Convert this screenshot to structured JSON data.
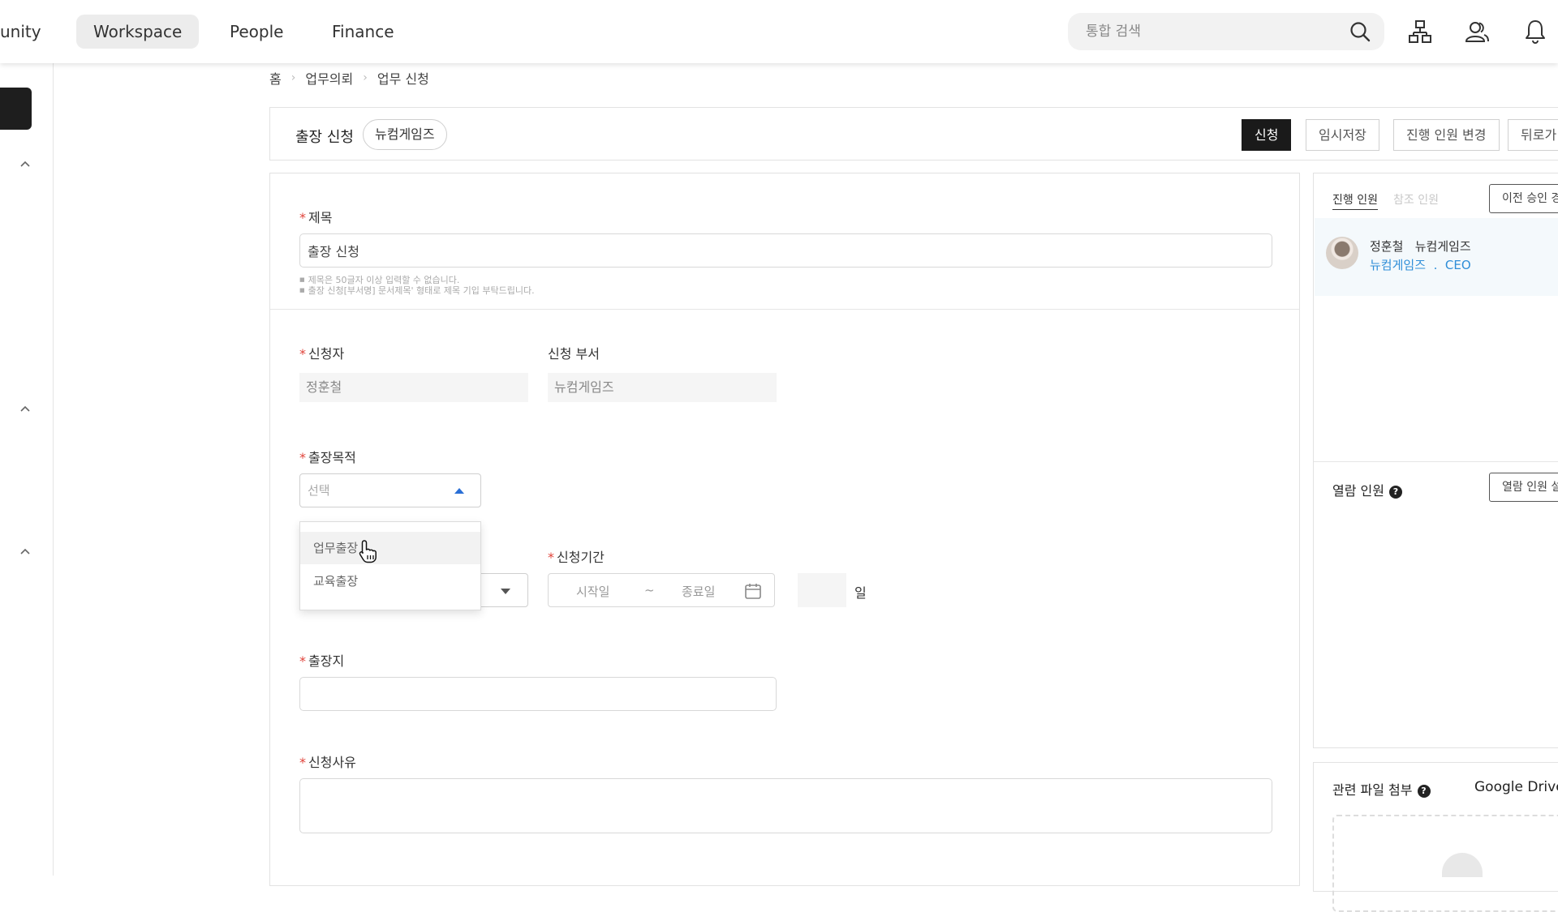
{
  "topnav": {
    "items": [
      {
        "label": "Community",
        "display": "unity",
        "active": false
      },
      {
        "label": "Workspace",
        "active": true
      },
      {
        "label": "People",
        "active": false
      },
      {
        "label": "Finance",
        "active": false
      }
    ],
    "search": {
      "placeholder": "통합 검색"
    },
    "icons": [
      "search-icon",
      "org-chart-icon",
      "contacts-icon",
      "bell-icon"
    ]
  },
  "breadcrumb": [
    "홈",
    "업무의뢰",
    "업무 신청"
  ],
  "header": {
    "title": "출장 신청",
    "company_chip": "뉴컴게임즈",
    "buttons": {
      "submit": "신청",
      "save_draft": "임시저장",
      "change_approvers": "진행 인원 변경",
      "back": "뒤로가기",
      "back_display": "뒤로가"
    }
  },
  "form": {
    "title_field": {
      "label": "제목",
      "value": "출장 신청",
      "hints": [
        "제목은 50글자 이상 입력할 수 없습니다.",
        "출장 신청[부서명] 문서제목' 형태로 제목 기입 부탁드립니다."
      ]
    },
    "applicant": {
      "label": "신청자",
      "value": "정훈철"
    },
    "department": {
      "label": "신청 부서",
      "value": "뉴컴게임즈"
    },
    "purpose": {
      "label": "출장목적",
      "placeholder": "선택",
      "options": [
        "업무출장",
        "교육출장"
      ],
      "hovered_option": "업무출장"
    },
    "period": {
      "label": "신청기간",
      "start_placeholder": "시작일",
      "separator": "~",
      "end_placeholder": "종료일",
      "days_unit": "일"
    },
    "destination": {
      "label": "출장지",
      "value": ""
    },
    "reason": {
      "label": "신청사유",
      "value": ""
    }
  },
  "right_panel": {
    "tabs": [
      {
        "label": "진행 인원",
        "active": true
      },
      {
        "label": "참조 인원",
        "active": false
      }
    ],
    "prev_approval_button": "이전 승인 경",
    "approver": {
      "name": "정훈철",
      "company": "뉴컴게임즈",
      "org": "뉴컴게임즈",
      "dot": ".",
      "role": "CEO"
    },
    "viewers": {
      "label": "열람 인원",
      "button": "열람 인원 설"
    }
  },
  "files": {
    "label": "관련 파일 첨부",
    "drive_label": "Google Drive"
  },
  "colors": {
    "accent_blue": "#2f8ed8",
    "primary_button": "#1a1a1a",
    "required_mark": "#e0433a"
  }
}
